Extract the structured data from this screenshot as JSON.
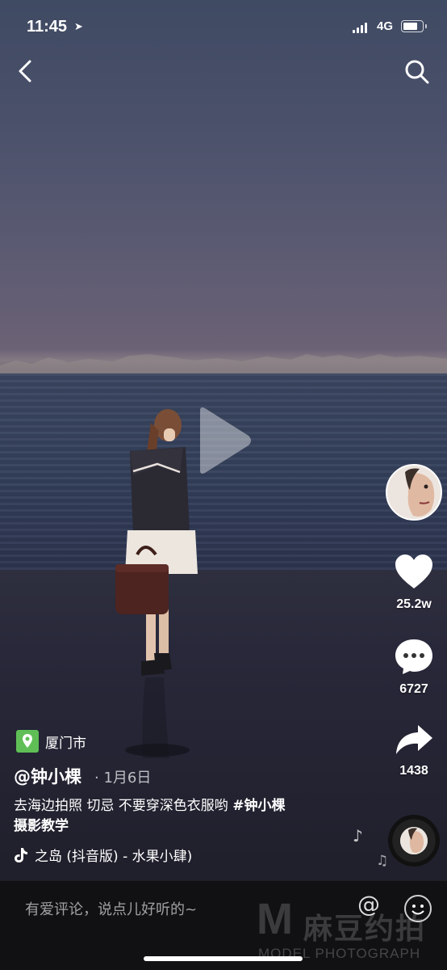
{
  "status_bar": {
    "time": "11:45",
    "network": "4G",
    "battery_level": 0.85
  },
  "video": {
    "location": "厦门市",
    "author": "@钟小棵",
    "date": "· 1月6日",
    "caption_text": "去海边拍照 切忌 不要穿深色衣服哟 ",
    "caption_tags": [
      "#钟小棵",
      "摄影教学"
    ],
    "music": "之岛 (抖音版) - 水果小肆)"
  },
  "right_rail": {
    "likes": "25.2w",
    "comments": "6727",
    "shares": "1438"
  },
  "bottom_bar": {
    "comment_placeholder": "有爱评论，说点儿好听的~"
  },
  "watermark": {
    "logo_letter": "M",
    "brand_cn": "麻豆约拍",
    "brand_en": "MODEL PHOTOGRAPH"
  },
  "icons": [
    "back-icon",
    "search-icon",
    "play-icon",
    "heart-icon",
    "comment-icon",
    "share-icon",
    "location-pin-icon",
    "tiktok-note-icon",
    "music-disc-icon",
    "at-icon",
    "emoji-icon"
  ]
}
